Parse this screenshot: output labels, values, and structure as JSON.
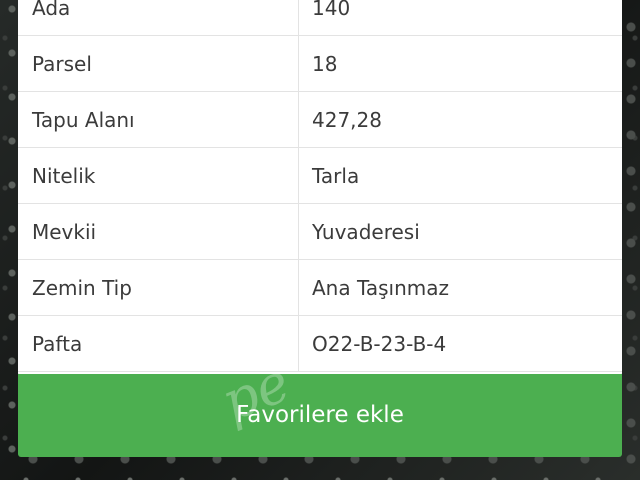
{
  "properties": [
    {
      "label": "Ada",
      "value": "140"
    },
    {
      "label": "Parsel",
      "value": "18"
    },
    {
      "label": "Tapu Alanı",
      "value": "427,28"
    },
    {
      "label": "Nitelik",
      "value": "Tarla"
    },
    {
      "label": "Mevkii",
      "value": "Yuvaderesi"
    },
    {
      "label": "Zemin Tip",
      "value": "Ana Taşınmaz"
    },
    {
      "label": "Pafta",
      "value": "O22-B-23-B-4"
    }
  ],
  "actions": {
    "favorite_label": "Favorilere ekle"
  },
  "colors": {
    "button_bg": "#4caf50",
    "button_text": "#ffffff",
    "text": "#3b3b3b",
    "border": "#e3e3e3"
  },
  "watermark": {
    "text": "pe"
  }
}
